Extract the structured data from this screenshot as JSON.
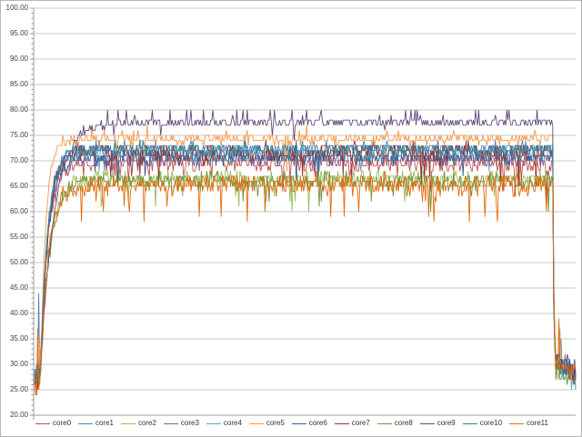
{
  "meta": {
    "description": "Line chart of 12 CPU core temperatures (deg C) during a load test: idle ~25-30, fast ramp, long noisy plateau (~63-78), sharp drop back to ~30 at the end",
    "title": ""
  },
  "colors": {
    "background": "#FFFFFF",
    "frame_border": "#B7B7B7",
    "gridline": "#C9C9C9",
    "axis_line": "#9B9B9B",
    "tick": "#9B9B9B",
    "label_text": "#404040",
    "legend_text": "#333333"
  },
  "chart_data": {
    "type": "line",
    "title": "",
    "xlabel": "",
    "ylabel": "",
    "ylim": [
      20,
      100
    ],
    "ytick_step": 5,
    "y_tick_labels": [
      "100.00",
      "95.00",
      "90.00",
      "85.00",
      "80.00",
      "75.00",
      "70.00",
      "65.00",
      "60.00",
      "55.00",
      "50.00",
      "45.00",
      "40.00",
      "35.00",
      "30.00",
      "25.00",
      "20.00"
    ],
    "x_tick_labels": [],
    "grid": "horizontal-only",
    "minor_ticks_every": 1,
    "legend_position": "bottom",
    "n_points": 520,
    "phases": {
      "idle": [
        0,
        6
      ],
      "ramp": [
        6,
        52
      ],
      "plateau": [
        52,
        498
      ],
      "drop": [
        498,
        500
      ],
      "cooldown": [
        500,
        520
      ]
    },
    "plateau_floor": 57.5,
    "series": [
      {
        "name": "core0",
        "color": "#C0504D",
        "idle_level": 27,
        "plateau_level": 69.5,
        "plateau_noise": 1.6,
        "dip_rate": 0.05,
        "dip_depth": 5,
        "spike_rate": 0,
        "spike_height": 0,
        "ramp_tau": 7,
        "end_level": 30
      },
      {
        "name": "core1",
        "color": "#4F81BD",
        "idle_level": 28,
        "plateau_level": 72.5,
        "plateau_noise": 1.2,
        "dip_rate": 0.02,
        "dip_depth": 3,
        "spike_rate": 0,
        "spike_height": 0,
        "ramp_tau": 7,
        "end_level": 31
      },
      {
        "name": "core2",
        "color": "#9BBB59",
        "idle_level": 27,
        "plateau_level": 66.5,
        "plateau_noise": 1.4,
        "dip_rate": 0.04,
        "dip_depth": 4,
        "spike_rate": 0,
        "spike_height": 0,
        "ramp_tau": 9,
        "end_level": 30
      },
      {
        "name": "core3",
        "color": "#8064A2",
        "idle_level": 28,
        "plateau_level": 70.5,
        "plateau_noise": 1.2,
        "dip_rate": 0.006,
        "dip_depth": 9,
        "spike_rate": 0,
        "spike_height": 0,
        "ramp_tau": 7,
        "end_level": 31
      },
      {
        "name": "core4",
        "color": "#4BACC6",
        "idle_level": 27,
        "plateau_level": 71.5,
        "plateau_noise": 1.2,
        "dip_rate": 0.02,
        "dip_depth": 4,
        "spike_rate": 0.008,
        "spike_height": 2,
        "ramp_tau": 7,
        "end_level": 30
      },
      {
        "name": "core5",
        "color": "#F79646",
        "idle_level": 26,
        "plateau_level": 74.3,
        "plateau_noise": 1.0,
        "dip_rate": 0.03,
        "dip_depth": 4,
        "spike_rate": 0.02,
        "spike_height": 1.5,
        "ramp_tau": 5,
        "end_level": 30
      },
      {
        "name": "core6",
        "color": "#376092",
        "idle_level": 28,
        "plateau_level": 70.8,
        "plateau_noise": 1.3,
        "dip_rate": 0.03,
        "dip_depth": 4,
        "spike_rate": 0,
        "spike_height": 0,
        "ramp_tau": 7,
        "end_level": 31
      },
      {
        "name": "core7",
        "color": "#953735",
        "idle_level": 27,
        "plateau_level": 71.8,
        "plateau_noise": 1.5,
        "dip_rate": 0.04,
        "dip_depth": 5,
        "spike_rate": 0,
        "spike_height": 0,
        "ramp_tau": 7,
        "end_level": 30
      },
      {
        "name": "core8",
        "color": "#76923C",
        "idle_level": 27,
        "plateau_level": 66.0,
        "plateau_noise": 1.5,
        "dip_rate": 0.05,
        "dip_depth": 5,
        "spike_rate": 0,
        "spike_height": 0,
        "ramp_tau": 9,
        "end_level": 29
      },
      {
        "name": "core9",
        "color": "#604A7B",
        "idle_level": 28,
        "plateau_level": 77.5,
        "plateau_noise": 0.65,
        "dip_rate": 0.01,
        "dip_depth": 2,
        "spike_rate": 0.07,
        "spike_height": 2.3,
        "ramp_tau": 13,
        "end_level": 31,
        "max_clamp": 80
      },
      {
        "name": "core10",
        "color": "#31849B",
        "idle_level": 27,
        "plateau_level": 72.3,
        "plateau_noise": 1.1,
        "dip_rate": 0.02,
        "dip_depth": 3,
        "spike_rate": 0,
        "spike_height": 0,
        "ramp_tau": 7,
        "end_level": 30
      },
      {
        "name": "core11",
        "color": "#E36C09",
        "idle_level": 26,
        "plateau_level": 65.3,
        "plateau_noise": 1.7,
        "dip_rate": 0.07,
        "dip_depth": 6,
        "spike_rate": 0.01,
        "spike_height": 1.5,
        "ramp_tau": 8,
        "end_level": 30
      }
    ],
    "events": [
      {
        "series": 1,
        "i": 4,
        "value": 44
      },
      {
        "series": 11,
        "i": 3,
        "value": 37
      },
      {
        "series": 0,
        "i": 2,
        "value": 24
      },
      {
        "series": 11,
        "i": 1,
        "value": 24
      },
      {
        "series": 5,
        "i": 5,
        "value": 35
      },
      {
        "series": 11,
        "i": 503,
        "value": 39
      },
      {
        "series": 5,
        "i": 504,
        "value": 37
      },
      {
        "series": 1,
        "i": 505,
        "value": 35
      }
    ]
  }
}
